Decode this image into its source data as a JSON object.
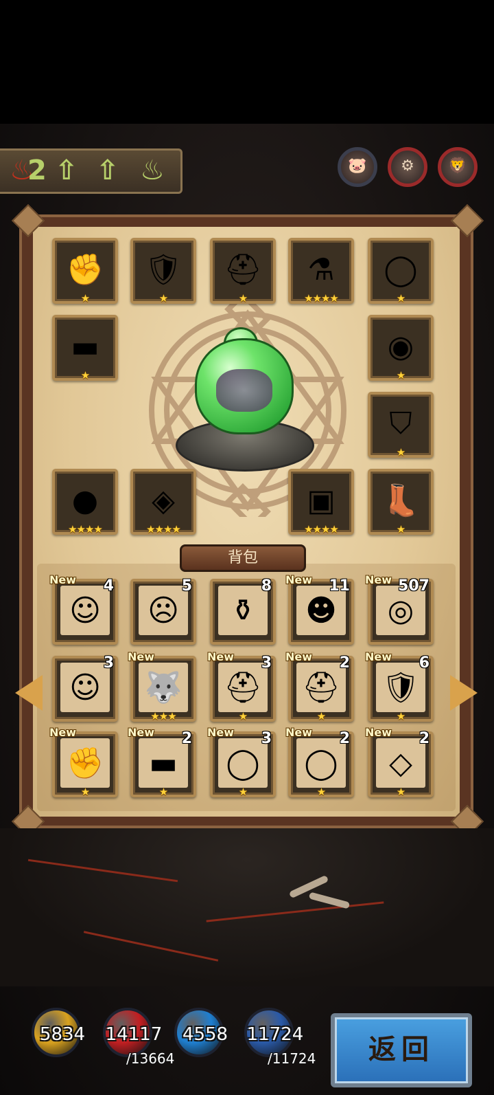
{
  "status_strip": {
    "flame_count": "2",
    "arrow_1": "⇧",
    "arrow_2": "⇧",
    "figure": "♨"
  },
  "top_tokens": [
    {
      "icon": "pig-icon"
    },
    {
      "icon": "gear-icon"
    },
    {
      "icon": "lion-icon"
    }
  ],
  "equipment": [
    {
      "icon": "gauntlet-icon",
      "glyph": "✊",
      "stars": "★"
    },
    {
      "icon": "chest-armor-icon",
      "glyph": "🛡",
      "stars": "★"
    },
    {
      "icon": "winged-helmet-icon",
      "glyph": "⛑",
      "stars": "★"
    },
    {
      "icon": "cauldron-icon",
      "glyph": "⚗",
      "stars": "★★★★"
    },
    {
      "icon": "amulet-icon",
      "glyph": "◯",
      "stars": "★"
    },
    {
      "icon": "belt-icon",
      "glyph": "▬",
      "stars": "★"
    },
    {
      "icon": "ring-icon",
      "glyph": "◉",
      "stars": "★"
    },
    {
      "icon": "cape-icon",
      "glyph": "⛉",
      "stars": "★"
    },
    {
      "icon": "slime-orb-icon",
      "glyph": "●",
      "stars": "★★★★"
    },
    {
      "icon": "map-icon",
      "glyph": "◈",
      "stars": "★★★★"
    },
    {
      "icon": "chest-box-icon",
      "glyph": "▣",
      "stars": "★★★★"
    },
    {
      "icon": "boots-icon",
      "glyph": "👢",
      "stars": "★"
    }
  ],
  "bag_title": "背包",
  "bag": [
    {
      "icon": "yellow-monster-icon",
      "glyph": "☺",
      "new": "New",
      "count": "4",
      "stars": ""
    },
    {
      "icon": "pink-monster-icon",
      "glyph": "☹",
      "new": "",
      "count": "5",
      "stars": ""
    },
    {
      "icon": "blue-treasure-icon",
      "glyph": "⚱",
      "new": "",
      "count": "8",
      "stars": ""
    },
    {
      "icon": "blue-slime-icon",
      "glyph": "☻",
      "new": "New",
      "count": "11",
      "stars": ""
    },
    {
      "icon": "coin-icon",
      "glyph": "◎",
      "new": "New",
      "count": "507",
      "stars": ""
    },
    {
      "icon": "green-monster-icon",
      "glyph": "☺",
      "new": "",
      "count": "3",
      "stars": ""
    },
    {
      "icon": "wolf-icon",
      "glyph": "🐺",
      "new": "New",
      "count": "",
      "stars": "★★★"
    },
    {
      "icon": "winged-helmet-icon",
      "glyph": "⛑",
      "new": "New",
      "count": "3",
      "stars": "★"
    },
    {
      "icon": "horned-helmet-icon",
      "glyph": "⛑",
      "new": "New",
      "count": "2",
      "stars": "★"
    },
    {
      "icon": "chest-armor-icon",
      "glyph": "🛡",
      "new": "New",
      "count": "6",
      "stars": "★"
    },
    {
      "icon": "gauntlet-icon",
      "glyph": "✊",
      "new": "New",
      "count": "",
      "stars": "★"
    },
    {
      "icon": "belt-icon",
      "glyph": "▬",
      "new": "New",
      "count": "2",
      "stars": "★"
    },
    {
      "icon": "silver-ring-icon",
      "glyph": "◯",
      "new": "New",
      "count": "3",
      "stars": "★"
    },
    {
      "icon": "amulet-icon",
      "glyph": "◯",
      "new": "New",
      "count": "2",
      "stars": "★"
    },
    {
      "icon": "ruby-necklace-icon",
      "glyph": "◇",
      "new": "New",
      "count": "2",
      "stars": "★"
    }
  ],
  "resources": [
    {
      "icon": "attack-icon",
      "value": "5834",
      "max": "",
      "color": "#d9a21f"
    },
    {
      "icon": "health-icon",
      "value": "14117",
      "max": "/13664",
      "color": "#c21f22"
    },
    {
      "icon": "defense-icon",
      "value": "4558",
      "max": "",
      "color": "#1f7fd0"
    },
    {
      "icon": "mana-icon",
      "value": "11724",
      "max": "/11724",
      "color": "#2a5aa8"
    }
  ],
  "back_label": "返回"
}
